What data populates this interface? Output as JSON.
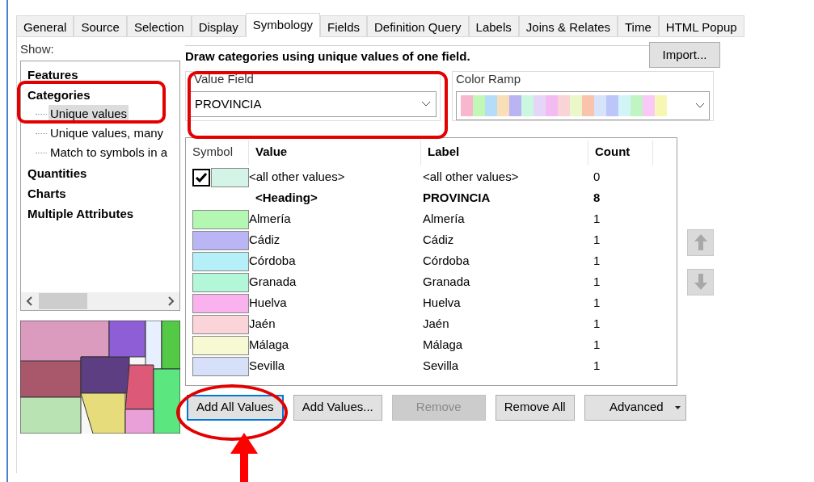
{
  "tabs": [
    {
      "label": "General",
      "selected": false
    },
    {
      "label": "Source",
      "selected": false
    },
    {
      "label": "Selection",
      "selected": false
    },
    {
      "label": "Display",
      "selected": false
    },
    {
      "label": "Symbology",
      "selected": true
    },
    {
      "label": "Fields",
      "selected": false
    },
    {
      "label": "Definition Query",
      "selected": false
    },
    {
      "label": "Labels",
      "selected": false
    },
    {
      "label": "Joins & Relates",
      "selected": false
    },
    {
      "label": "Time",
      "selected": false
    },
    {
      "label": "HTML Popup",
      "selected": false
    }
  ],
  "show": {
    "label": "Show:",
    "tree": [
      {
        "label": "Features",
        "selected": false
      },
      {
        "label": "Categories",
        "selected": false,
        "children": [
          {
            "label": "Unique values",
            "selected": true
          },
          {
            "label": "Unique values, many",
            "selected": false
          },
          {
            "label": "Match to symbols in a",
            "selected": false
          }
        ]
      },
      {
        "label": "Quantities",
        "selected": false
      },
      {
        "label": "Charts",
        "selected": false
      },
      {
        "label": "Multiple Attributes",
        "selected": false
      }
    ]
  },
  "description": "Draw categories using unique values of one field.",
  "import_button": "Import...",
  "value_field": {
    "label": "Value Field",
    "value": "PROVINCIA"
  },
  "color_ramp": {
    "label": "Color Ramp"
  },
  "table": {
    "columns": [
      "Symbol",
      "Value",
      "Label",
      "Count"
    ],
    "rows": [
      {
        "kind": "other",
        "checked": true,
        "color": "#d4f4e8",
        "value": "<all other values>",
        "label": "<all other values>",
        "count": "0"
      },
      {
        "kind": "heading",
        "value": "<Heading>",
        "label": "PROVINCIA",
        "count": "8"
      },
      {
        "kind": "item",
        "color": "#b3f7b3",
        "value": "Almería",
        "label": "Almería",
        "count": "1"
      },
      {
        "kind": "item",
        "color": "#bab6f5",
        "value": "Cádiz",
        "label": "Cádiz",
        "count": "1"
      },
      {
        "kind": "item",
        "color": "#b5f0f8",
        "value": "Córdoba",
        "label": "Córdoba",
        "count": "1"
      },
      {
        "kind": "item",
        "color": "#b3f7d9",
        "value": "Granada",
        "label": "Granada",
        "count": "1"
      },
      {
        "kind": "item",
        "color": "#f9b2ee",
        "value": "Huelva",
        "label": "Huelva",
        "count": "1"
      },
      {
        "kind": "item",
        "color": "#fad4d8",
        "value": "Jaén",
        "label": "Jaén",
        "count": "1"
      },
      {
        "kind": "item",
        "color": "#f6f9d2",
        "value": "Málaga",
        "label": "Málaga",
        "count": "1"
      },
      {
        "kind": "item",
        "color": "#d6e0f8",
        "value": "Sevilla",
        "label": "Sevilla",
        "count": "1"
      }
    ]
  },
  "move_buttons": {
    "disabled": true
  },
  "buttons": [
    {
      "label": "Add All Values",
      "focused": true,
      "disabled": false
    },
    {
      "label": "Add Values...",
      "focused": false,
      "disabled": false
    },
    {
      "label": "Remove",
      "focused": false,
      "disabled": true
    },
    {
      "label": "Remove All",
      "focused": false,
      "disabled": false
    }
  ],
  "advanced_button": "Advanced"
}
